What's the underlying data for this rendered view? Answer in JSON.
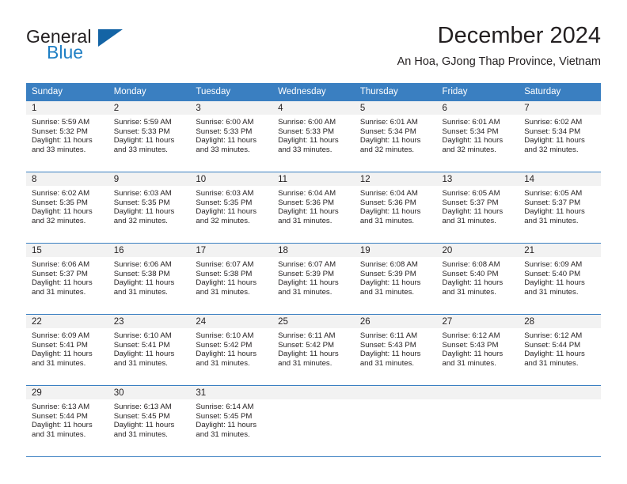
{
  "brand": {
    "line1": "General",
    "line2": "Blue",
    "triangle_color": "#1464a5",
    "blue_color": "#1f7fc4"
  },
  "header": {
    "title": "December 2024",
    "subtitle": "An Hoa, GJong Thap Province, Vietnam"
  },
  "theme": {
    "header_bg": "#3a7fc1",
    "daynum_bg": "#f2f2f2",
    "text": "#231f20"
  },
  "calendar": {
    "weekday_headers": [
      "Sunday",
      "Monday",
      "Tuesday",
      "Wednesday",
      "Thursday",
      "Friday",
      "Saturday"
    ],
    "weeks": [
      [
        {
          "day": "1",
          "sunrise": "Sunrise: 5:59 AM",
          "sunset": "Sunset: 5:32 PM",
          "daylight1": "Daylight: 11 hours",
          "daylight2": "and 33 minutes."
        },
        {
          "day": "2",
          "sunrise": "Sunrise: 5:59 AM",
          "sunset": "Sunset: 5:33 PM",
          "daylight1": "Daylight: 11 hours",
          "daylight2": "and 33 minutes."
        },
        {
          "day": "3",
          "sunrise": "Sunrise: 6:00 AM",
          "sunset": "Sunset: 5:33 PM",
          "daylight1": "Daylight: 11 hours",
          "daylight2": "and 33 minutes."
        },
        {
          "day": "4",
          "sunrise": "Sunrise: 6:00 AM",
          "sunset": "Sunset: 5:33 PM",
          "daylight1": "Daylight: 11 hours",
          "daylight2": "and 33 minutes."
        },
        {
          "day": "5",
          "sunrise": "Sunrise: 6:01 AM",
          "sunset": "Sunset: 5:34 PM",
          "daylight1": "Daylight: 11 hours",
          "daylight2": "and 32 minutes."
        },
        {
          "day": "6",
          "sunrise": "Sunrise: 6:01 AM",
          "sunset": "Sunset: 5:34 PM",
          "daylight1": "Daylight: 11 hours",
          "daylight2": "and 32 minutes."
        },
        {
          "day": "7",
          "sunrise": "Sunrise: 6:02 AM",
          "sunset": "Sunset: 5:34 PM",
          "daylight1": "Daylight: 11 hours",
          "daylight2": "and 32 minutes."
        }
      ],
      [
        {
          "day": "8",
          "sunrise": "Sunrise: 6:02 AM",
          "sunset": "Sunset: 5:35 PM",
          "daylight1": "Daylight: 11 hours",
          "daylight2": "and 32 minutes."
        },
        {
          "day": "9",
          "sunrise": "Sunrise: 6:03 AM",
          "sunset": "Sunset: 5:35 PM",
          "daylight1": "Daylight: 11 hours",
          "daylight2": "and 32 minutes."
        },
        {
          "day": "10",
          "sunrise": "Sunrise: 6:03 AM",
          "sunset": "Sunset: 5:35 PM",
          "daylight1": "Daylight: 11 hours",
          "daylight2": "and 32 minutes."
        },
        {
          "day": "11",
          "sunrise": "Sunrise: 6:04 AM",
          "sunset": "Sunset: 5:36 PM",
          "daylight1": "Daylight: 11 hours",
          "daylight2": "and 31 minutes."
        },
        {
          "day": "12",
          "sunrise": "Sunrise: 6:04 AM",
          "sunset": "Sunset: 5:36 PM",
          "daylight1": "Daylight: 11 hours",
          "daylight2": "and 31 minutes."
        },
        {
          "day": "13",
          "sunrise": "Sunrise: 6:05 AM",
          "sunset": "Sunset: 5:37 PM",
          "daylight1": "Daylight: 11 hours",
          "daylight2": "and 31 minutes."
        },
        {
          "day": "14",
          "sunrise": "Sunrise: 6:05 AM",
          "sunset": "Sunset: 5:37 PM",
          "daylight1": "Daylight: 11 hours",
          "daylight2": "and 31 minutes."
        }
      ],
      [
        {
          "day": "15",
          "sunrise": "Sunrise: 6:06 AM",
          "sunset": "Sunset: 5:37 PM",
          "daylight1": "Daylight: 11 hours",
          "daylight2": "and 31 minutes."
        },
        {
          "day": "16",
          "sunrise": "Sunrise: 6:06 AM",
          "sunset": "Sunset: 5:38 PM",
          "daylight1": "Daylight: 11 hours",
          "daylight2": "and 31 minutes."
        },
        {
          "day": "17",
          "sunrise": "Sunrise: 6:07 AM",
          "sunset": "Sunset: 5:38 PM",
          "daylight1": "Daylight: 11 hours",
          "daylight2": "and 31 minutes."
        },
        {
          "day": "18",
          "sunrise": "Sunrise: 6:07 AM",
          "sunset": "Sunset: 5:39 PM",
          "daylight1": "Daylight: 11 hours",
          "daylight2": "and 31 minutes."
        },
        {
          "day": "19",
          "sunrise": "Sunrise: 6:08 AM",
          "sunset": "Sunset: 5:39 PM",
          "daylight1": "Daylight: 11 hours",
          "daylight2": "and 31 minutes."
        },
        {
          "day": "20",
          "sunrise": "Sunrise: 6:08 AM",
          "sunset": "Sunset: 5:40 PM",
          "daylight1": "Daylight: 11 hours",
          "daylight2": "and 31 minutes."
        },
        {
          "day": "21",
          "sunrise": "Sunrise: 6:09 AM",
          "sunset": "Sunset: 5:40 PM",
          "daylight1": "Daylight: 11 hours",
          "daylight2": "and 31 minutes."
        }
      ],
      [
        {
          "day": "22",
          "sunrise": "Sunrise: 6:09 AM",
          "sunset": "Sunset: 5:41 PM",
          "daylight1": "Daylight: 11 hours",
          "daylight2": "and 31 minutes."
        },
        {
          "day": "23",
          "sunrise": "Sunrise: 6:10 AM",
          "sunset": "Sunset: 5:41 PM",
          "daylight1": "Daylight: 11 hours",
          "daylight2": "and 31 minutes."
        },
        {
          "day": "24",
          "sunrise": "Sunrise: 6:10 AM",
          "sunset": "Sunset: 5:42 PM",
          "daylight1": "Daylight: 11 hours",
          "daylight2": "and 31 minutes."
        },
        {
          "day": "25",
          "sunrise": "Sunrise: 6:11 AM",
          "sunset": "Sunset: 5:42 PM",
          "daylight1": "Daylight: 11 hours",
          "daylight2": "and 31 minutes."
        },
        {
          "day": "26",
          "sunrise": "Sunrise: 6:11 AM",
          "sunset": "Sunset: 5:43 PM",
          "daylight1": "Daylight: 11 hours",
          "daylight2": "and 31 minutes."
        },
        {
          "day": "27",
          "sunrise": "Sunrise: 6:12 AM",
          "sunset": "Sunset: 5:43 PM",
          "daylight1": "Daylight: 11 hours",
          "daylight2": "and 31 minutes."
        },
        {
          "day": "28",
          "sunrise": "Sunrise: 6:12 AM",
          "sunset": "Sunset: 5:44 PM",
          "daylight1": "Daylight: 11 hours",
          "daylight2": "and 31 minutes."
        }
      ],
      [
        {
          "day": "29",
          "sunrise": "Sunrise: 6:13 AM",
          "sunset": "Sunset: 5:44 PM",
          "daylight1": "Daylight: 11 hours",
          "daylight2": "and 31 minutes."
        },
        {
          "day": "30",
          "sunrise": "Sunrise: 6:13 AM",
          "sunset": "Sunset: 5:45 PM",
          "daylight1": "Daylight: 11 hours",
          "daylight2": "and 31 minutes."
        },
        {
          "day": "31",
          "sunrise": "Sunrise: 6:14 AM",
          "sunset": "Sunset: 5:45 PM",
          "daylight1": "Daylight: 11 hours",
          "daylight2": "and 31 minutes."
        },
        {
          "day": "",
          "sunrise": "",
          "sunset": "",
          "daylight1": "",
          "daylight2": ""
        },
        {
          "day": "",
          "sunrise": "",
          "sunset": "",
          "daylight1": "",
          "daylight2": ""
        },
        {
          "day": "",
          "sunrise": "",
          "sunset": "",
          "daylight1": "",
          "daylight2": ""
        },
        {
          "day": "",
          "sunrise": "",
          "sunset": "",
          "daylight1": "",
          "daylight2": ""
        }
      ]
    ]
  }
}
